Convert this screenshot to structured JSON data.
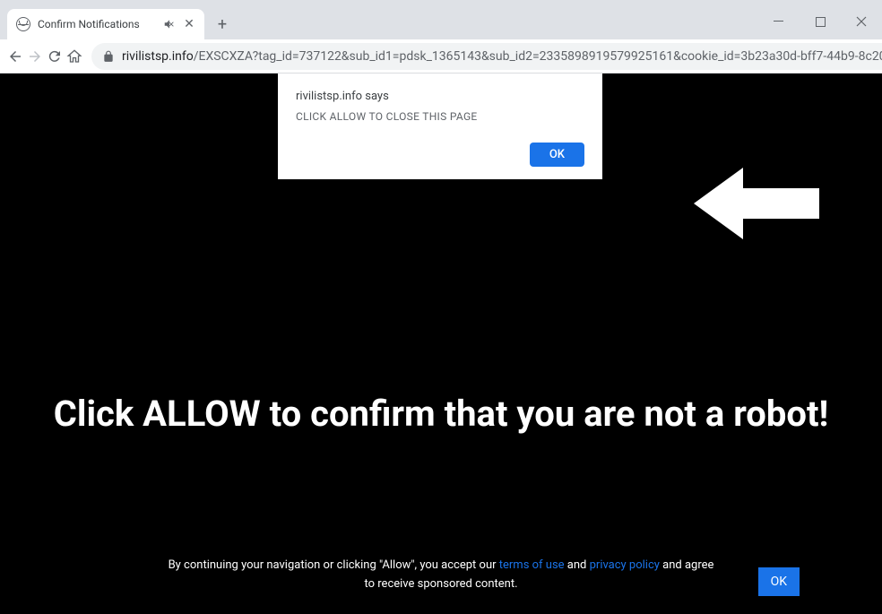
{
  "tab": {
    "title": "Confirm Notifications"
  },
  "url": {
    "domain": "rivilistsp.info",
    "path": "/EXSCXZA?tag_id=737122&sub_id1=pdsk_1365143&sub_id2=2335898919579925161&cookie_id=3b23a30d-bff7-44b9-8c20..."
  },
  "dialog": {
    "origin": "rivilistsp.info says",
    "message": "CLICK ALLOW TO CLOSE THIS PAGE",
    "ok_label": "OK"
  },
  "page": {
    "headline": "Click ALLOW to confirm that you are not a robot!",
    "footer_pre": "By continuing your navigation or clicking \"Allow\", you accept our ",
    "terms_link": "terms of use",
    "footer_mid": " and ",
    "privacy_link": "privacy policy",
    "footer_post": " and agree",
    "footer_line2": "to receive sponsored content.",
    "footer_ok": "OK"
  }
}
